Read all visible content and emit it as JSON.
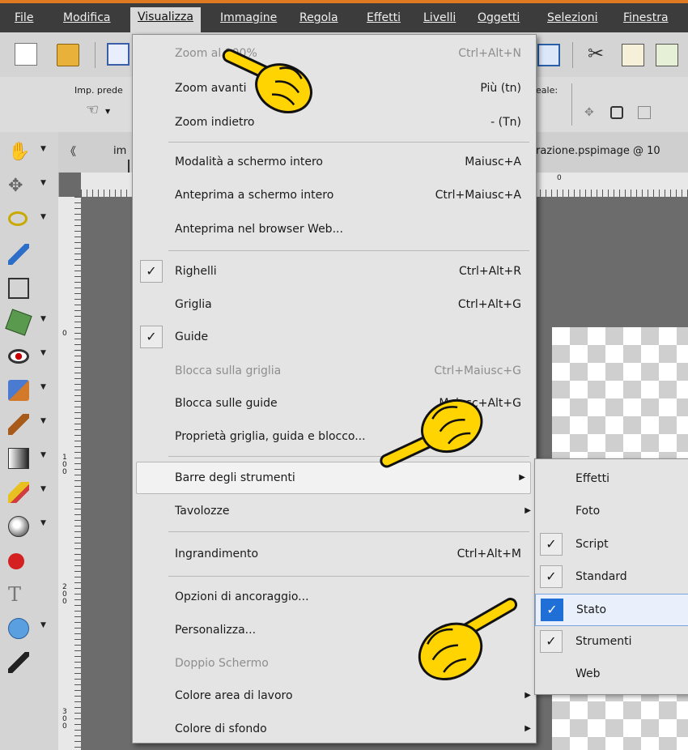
{
  "menubar": {
    "items": [
      {
        "label": "File"
      },
      {
        "label": "Modifica"
      },
      {
        "label": "Visualizza"
      },
      {
        "label": "Immagine"
      },
      {
        "label": "Regola"
      },
      {
        "label": "Effetti"
      },
      {
        "label": "Livelli"
      },
      {
        "label": "Oggetti"
      },
      {
        "label": "Selezioni"
      },
      {
        "label": "Finestra"
      }
    ]
  },
  "options_bar": {
    "preset_label": "Imp. prede",
    "right_label": "eale:"
  },
  "document": {
    "tab_left": "im",
    "tab_right": "razione.pspimage @ 10"
  },
  "ruler": {
    "top_label": "0",
    "left_labels": [
      "0",
      "1 0 0",
      "2 0 0",
      "3 0 0"
    ]
  },
  "view_menu": {
    "items": [
      {
        "label": "Zoom al 100%",
        "shortcut": "Ctrl+Alt+N",
        "disabled": true
      },
      {
        "label": "Zoom avanti",
        "shortcut": "Più (tn)"
      },
      {
        "label": "Zoom indietro",
        "shortcut": "- (Tn)"
      },
      {
        "label": "Modalità a schermo intero",
        "shortcut": "Maiusc+A"
      },
      {
        "label": "Anteprima a schermo intero",
        "shortcut": "Ctrl+Maiusc+A"
      },
      {
        "label": "Anteprima nel browser Web...",
        "shortcut": ""
      },
      {
        "label": "Righelli",
        "shortcut": "Ctrl+Alt+R",
        "checked": true
      },
      {
        "label": "Griglia",
        "shortcut": "Ctrl+Alt+G"
      },
      {
        "label": "Guide",
        "shortcut": "",
        "checked": true
      },
      {
        "label": "Blocca sulla griglia",
        "shortcut": "Ctrl+Maiusc+G",
        "disabled": true
      },
      {
        "label": "Blocca sulle guide",
        "shortcut": "Maiusc+Alt+G"
      },
      {
        "label": "Proprietà griglia, guida e blocco...",
        "shortcut": ""
      },
      {
        "label": "Barre degli strumenti",
        "shortcut": "",
        "submenu": true,
        "highlighted": true
      },
      {
        "label": "Tavolozze",
        "shortcut": "",
        "submenu": true
      },
      {
        "label": "Ingrandimento",
        "shortcut": "Ctrl+Alt+M"
      },
      {
        "label": "Opzioni di ancoraggio...",
        "shortcut": ""
      },
      {
        "label": "Personalizza...",
        "shortcut": ""
      },
      {
        "label": "Doppio Schermo",
        "shortcut": "",
        "disabled": true
      },
      {
        "label": "Colore area di lavoro",
        "shortcut": "",
        "submenu": true
      },
      {
        "label": "Colore di sfondo",
        "shortcut": "",
        "submenu": true
      }
    ]
  },
  "toolbars_submenu": {
    "items": [
      {
        "label": "Effetti",
        "checked": false
      },
      {
        "label": "Foto",
        "checked": false
      },
      {
        "label": "Script",
        "checked": true
      },
      {
        "label": "Standard",
        "checked": true
      },
      {
        "label": "Stato",
        "checked": true,
        "highlighted": true
      },
      {
        "label": "Strumenti",
        "checked": true
      },
      {
        "label": "Web",
        "checked": false
      }
    ]
  },
  "glyphs": {
    "check": "✓",
    "submenu_arrow": "▶",
    "dropdown": "▼",
    "collapse": "《"
  },
  "colors": {
    "accent_orange": "#e07a22",
    "menubar_bg": "#3c3c3c",
    "highlight_blue": "#1f6fd6",
    "hand_yellow": "#ffd400"
  }
}
